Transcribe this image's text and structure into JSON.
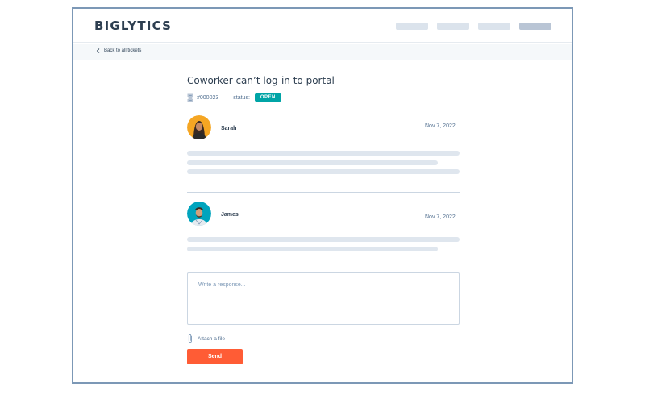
{
  "header": {
    "logo_text": "BIGLYTICS"
  },
  "breadcrumb": {
    "back_label": "Back to all tickets"
  },
  "ticket": {
    "title": "Coworker can’t log-in to portal",
    "id": "#000023",
    "status_label": "status:",
    "status_value": "OPEN"
  },
  "messages": [
    {
      "author": "Sarah",
      "date": "Nov 7, 2022"
    },
    {
      "author": "James",
      "date": "Nov 7, 2022"
    }
  ],
  "composer": {
    "placeholder": "Write a response...",
    "attach_label": "Attach a file",
    "send_label": "Send"
  },
  "colors": {
    "status_badge": "#00a4a6",
    "send_button": "#ff5c35",
    "sarah_avatar_bg": "#f5a623",
    "james_avatar_bg": "#00a4bd"
  }
}
